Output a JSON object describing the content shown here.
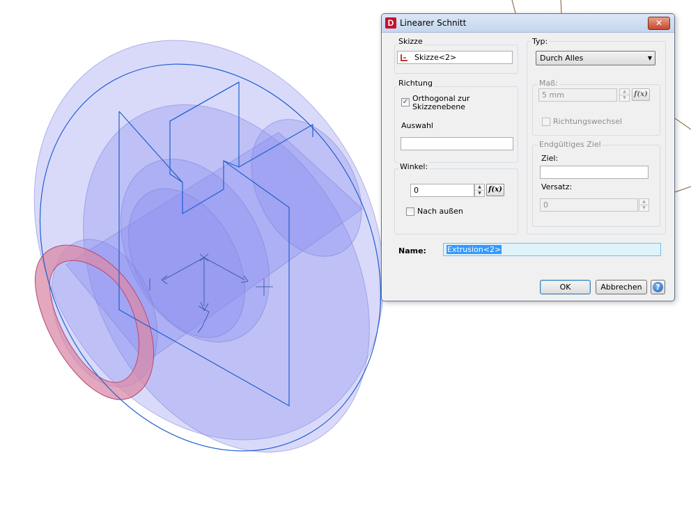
{
  "colors": {
    "body_fill": "#8a8cf0",
    "body_stroke": "#7b7fd6",
    "sketch_line": "#1f5fd0",
    "ring_fill": "#d98aa8",
    "ring_stroke": "#b04a75",
    "accent_selection": "#3399ff"
  },
  "dialog": {
    "app_icon_letter": "D",
    "title": "Linearer Schnitt",
    "close_icon": "close-icon",
    "skizze": {
      "label": "Skizze",
      "icon": "sketch-icon",
      "value": "Skizze<2>"
    },
    "richtung": {
      "label": "Richtung",
      "orthogonal_checked": true,
      "orthogonal_label_line1": "Orthogonal zur",
      "orthogonal_label_line2": "Skizzenebene",
      "auswahl_label": "Auswahl",
      "auswahl_value": ""
    },
    "winkel": {
      "label": "Winkel:",
      "value": "0",
      "nach_aussen_label": "Nach außen",
      "nach_aussen_checked": false
    },
    "typ": {
      "label": "Typ:",
      "selected": "Durch Alles"
    },
    "mass": {
      "label": "Maß:",
      "value": "5 mm",
      "richtungswechsel_label": "Richtungswechsel",
      "richtungswechsel_checked": false
    },
    "ziel": {
      "group_label": "Endgültiges Ziel",
      "ziel_label": "Ziel:",
      "ziel_value": "",
      "versatz_label": "Versatz:",
      "versatz_value": "0"
    },
    "fx_label": "f(x)",
    "name_label": "Name:",
    "name_value": "Extrusion<2>",
    "ok_label": "OK",
    "cancel_label": "Abbrechen",
    "help_glyph": "?"
  }
}
